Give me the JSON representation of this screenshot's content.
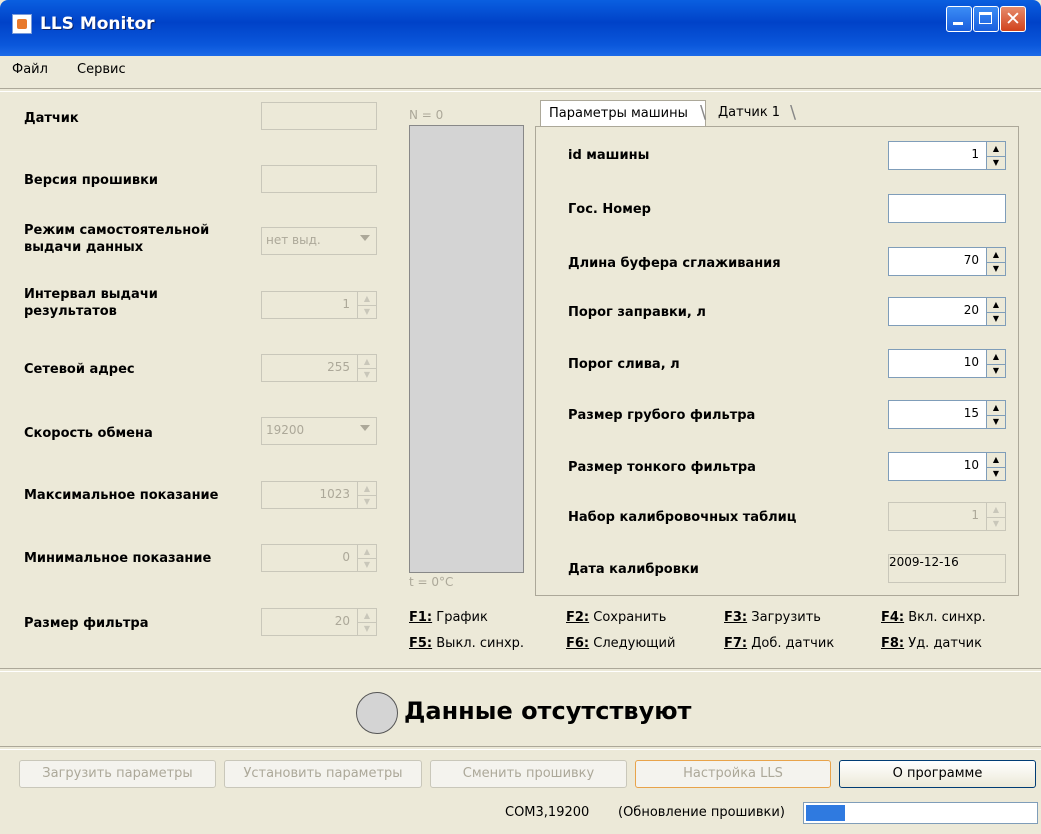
{
  "window": {
    "title": "LLS Monitor"
  },
  "menu": {
    "items": [
      "Файл",
      "Сервис"
    ]
  },
  "sensor": {
    "fields": [
      {
        "label": "Датчик",
        "value": ""
      },
      {
        "label": "Версия прошивки",
        "value": ""
      },
      {
        "label": "Режим самостоятельной выдачи данных",
        "value": "нет выд."
      },
      {
        "label": "Интервал выдачи результатов",
        "value": "1"
      },
      {
        "label": "Сетевой адрес",
        "value": "255"
      },
      {
        "label": "Скорость обмена",
        "value": "19200"
      },
      {
        "label": "Максимальное показание",
        "value": "1023"
      },
      {
        "label": "Минимальное показание",
        "value": "0"
      },
      {
        "label": "Размер фильтра",
        "value": "20"
      }
    ]
  },
  "gauge": {
    "top_label": "N = 0",
    "bottom_label": "t = 0°C",
    "level": 0
  },
  "tabs": [
    "Параметры машины",
    "Датчик 1"
  ],
  "machine": {
    "fields": [
      {
        "label": "id машины",
        "value": "1"
      },
      {
        "label": "Гос. Номер",
        "value": ""
      },
      {
        "label": "Длина буфера сглаживания",
        "value": "70"
      },
      {
        "label": "Порог заправки, л",
        "value": "20"
      },
      {
        "label": "Порог слива, л",
        "value": "10"
      },
      {
        "label": "Размер грубого фильтра",
        "value": "15"
      },
      {
        "label": "Размер тонкого фильтра",
        "value": "10"
      },
      {
        "label": "Набор калибровочных таблиц",
        "value": "1"
      },
      {
        "label": "Дата калибровки",
        "value": "2009-12-16"
      }
    ]
  },
  "shortcuts": [
    {
      "key": "F1:",
      "text": "График"
    },
    {
      "key": "F2:",
      "text": "Сохранить"
    },
    {
      "key": "F3:",
      "text": "Загрузить"
    },
    {
      "key": "F4:",
      "text": "Вкл. синхр."
    },
    {
      "key": "F5:",
      "text": "Выкл. синхр."
    },
    {
      "key": "F6:",
      "text": "Следующий"
    },
    {
      "key": "F7:",
      "text": "Доб. датчик"
    },
    {
      "key": "F8:",
      "text": "Уд. датчик"
    }
  ],
  "status": {
    "message": "Данные отсутствуют"
  },
  "buttons": {
    "load_params": "Загрузить параметры",
    "set_params": "Установить параметры",
    "change_firmware": "Сменить прошивку",
    "lls_settings": "Настройка LLS",
    "about": "О программе"
  },
  "statusbar": {
    "port": "COM3,19200",
    "mode": "(Обновление прошивки)",
    "progress": 0.17
  },
  "colors": {
    "titlebar": "#0a57db",
    "progress_fill": "#2f7ae0",
    "background": "#ece9d8"
  }
}
